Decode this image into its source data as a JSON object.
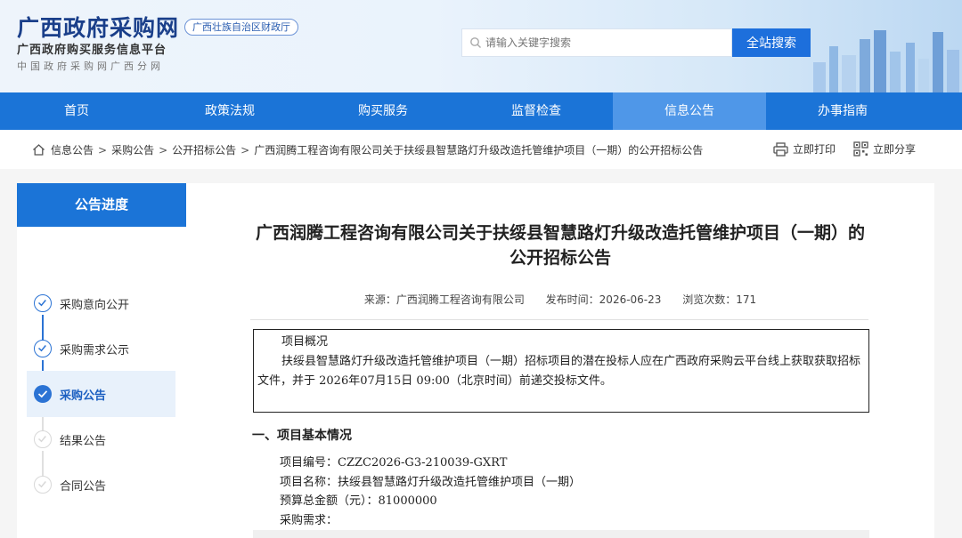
{
  "header": {
    "site_title": "广西政府采购网",
    "site_sub1": "广西政府购买服务信息平台",
    "site_sub2": "中国政府采购网广西分网",
    "gov_badge": "广西壮族自治区财政厅",
    "search_placeholder": "请输入关键字搜索",
    "search_button": "全站搜索"
  },
  "nav": {
    "items": [
      {
        "label": "首页"
      },
      {
        "label": "政策法规"
      },
      {
        "label": "购买服务"
      },
      {
        "label": "监督检查"
      },
      {
        "label": "信息公告",
        "active": true
      },
      {
        "label": "办事指南"
      }
    ],
    "active_color": "#4f97e8",
    "bar_color": "#1b74d7"
  },
  "breadcrumb": {
    "items": [
      "信息公告",
      "采购公告",
      "公开招标公告",
      "广西润腾工程咨询有限公司关于扶绥县智慧路灯升级改造托管维护项目（一期）的公开招标公告"
    ],
    "separator": ">",
    "print_label": "立即打印",
    "share_label": "立即分享"
  },
  "sidebar": {
    "title": "公告进度",
    "steps": [
      {
        "label": "采购意向公开",
        "state": "done"
      },
      {
        "label": "采购需求公示",
        "state": "done"
      },
      {
        "label": "采购公告",
        "state": "current"
      },
      {
        "label": "结果公告",
        "state": "todo"
      },
      {
        "label": "合同公告",
        "state": "todo"
      }
    ]
  },
  "article": {
    "title": "广西润腾工程咨询有限公司关于扶绥县智慧路灯升级改造托管维护项目（一期）的公开招标公告",
    "source": "来源：广西润腾工程咨询有限公司",
    "publish_time": "发布时间：2026-06-23",
    "views": "浏览次数：171",
    "summary_head": "项目概况",
    "summary_body": "扶绥县智慧路灯升级改造托管维护项目（一期）招标项目的潜在投标人应在广西政府采购云平台线上获取获取招标文件，并于 2026年07月15日 09:00（北京时间）前递交投标文件。",
    "section1": "一、项目基本情况",
    "info_rows": [
      "项目编号：CZZC2026-G3-210039-GXRT",
      "项目名称：扶绥县智慧路灯升级改造托管维护项目（一期）",
      "预算总金额（元）：81000000",
      "采购需求："
    ]
  }
}
